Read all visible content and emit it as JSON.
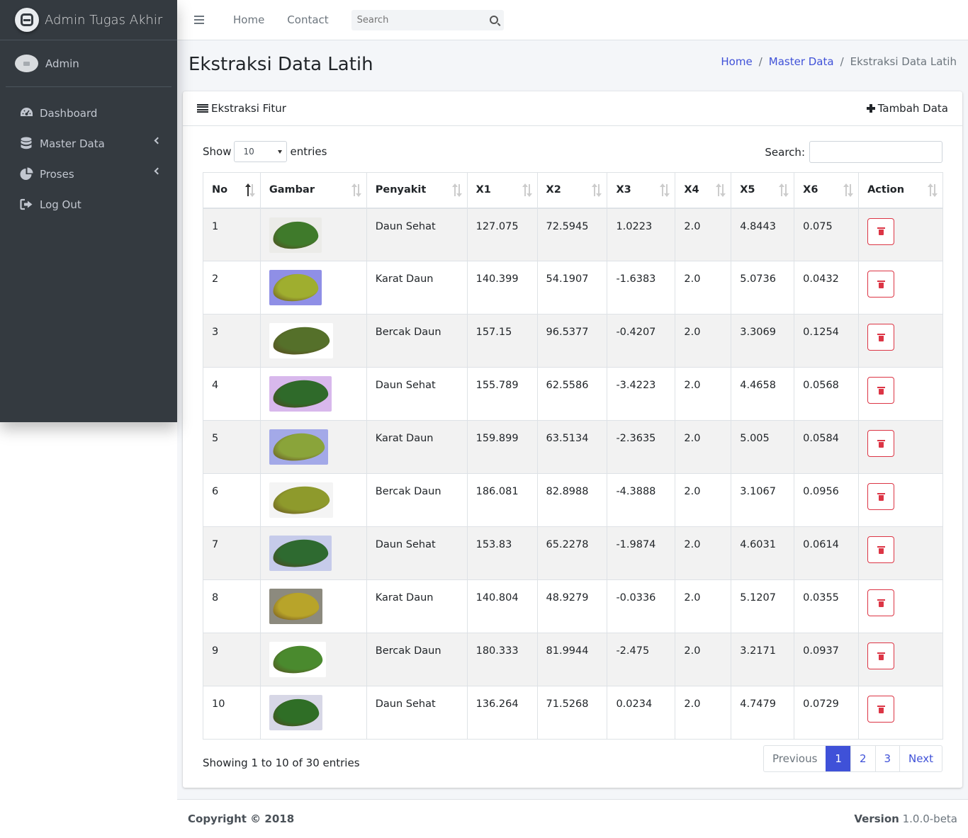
{
  "brand": {
    "title": "Admin Tugas Akhir"
  },
  "user": {
    "name": "Admin"
  },
  "sidebar": {
    "items": [
      {
        "label": "Dashboard",
        "icon": "dashboard-icon",
        "has_arrow": false
      },
      {
        "label": "Master Data",
        "icon": "database-icon",
        "has_arrow": true
      },
      {
        "label": "Proses",
        "icon": "pie-chart-icon",
        "has_arrow": true
      },
      {
        "label": "Log Out",
        "icon": "sign-out-icon",
        "has_arrow": false
      }
    ]
  },
  "topnav": {
    "links": [
      "Home",
      "Contact"
    ],
    "search_placeholder": "Search"
  },
  "page": {
    "title": "Ekstraksi Data Latih",
    "breadcrumb": {
      "home": "Home",
      "master": "Master Data",
      "current": "Ekstraksi Data Latih"
    }
  },
  "card": {
    "title": "Ekstraksi Fitur",
    "add_label": "Tambah Data"
  },
  "datatable": {
    "show_label": "Show",
    "entries_label": "entries",
    "page_length": "10",
    "search_label": "Search:",
    "columns": [
      "No",
      "Gambar",
      "Penyakit",
      "X1",
      "X2",
      "X3",
      "X4",
      "X5",
      "X6",
      "Action"
    ],
    "rows": [
      {
        "no": "1",
        "penyakit": "Daun Sehat",
        "x1": "127.075",
        "x2": "72.5945",
        "x3": "1.0223",
        "x4": "2.0",
        "x5": "4.8443",
        "x6": "0.075",
        "bg": "#ebebe8",
        "leaf": "#3f7a2b"
      },
      {
        "no": "2",
        "penyakit": "Karat Daun",
        "x1": "140.399",
        "x2": "54.1907",
        "x3": "-1.6383",
        "x4": "2.0",
        "x5": "5.0736",
        "x6": "0.0432",
        "bg": "#8f8fe6",
        "leaf": "#9fae2f"
      },
      {
        "no": "3",
        "penyakit": "Bercak Daun",
        "x1": "157.15",
        "x2": "96.5377",
        "x3": "-0.4207",
        "x4": "2.0",
        "x5": "3.3069",
        "x6": "0.1254",
        "bg": "#ffffff",
        "leaf": "#55702a"
      },
      {
        "no": "4",
        "penyakit": "Daun Sehat",
        "x1": "155.789",
        "x2": "62.5586",
        "x3": "-3.4223",
        "x4": "2.0",
        "x5": "4.4658",
        "x6": "0.0568",
        "bg": "#d8b8ec",
        "leaf": "#2f6a2a"
      },
      {
        "no": "5",
        "penyakit": "Karat Daun",
        "x1": "159.899",
        "x2": "63.5134",
        "x3": "-2.3635",
        "x4": "2.0",
        "x5": "5.005",
        "x6": "0.0584",
        "bg": "#a3a9e8",
        "leaf": "#8aa43a"
      },
      {
        "no": "6",
        "penyakit": "Bercak Daun",
        "x1": "186.081",
        "x2": "82.8988",
        "x3": "-4.3888",
        "x4": "2.0",
        "x5": "3.1067",
        "x6": "0.0956",
        "bg": "#f4f4f4",
        "leaf": "#8e9a2c"
      },
      {
        "no": "7",
        "penyakit": "Daun Sehat",
        "x1": "153.83",
        "x2": "65.2278",
        "x3": "-1.9874",
        "x4": "2.0",
        "x5": "4.6031",
        "x6": "0.0614",
        "bg": "#c6cbea",
        "leaf": "#2e6a30"
      },
      {
        "no": "8",
        "penyakit": "Karat Daun",
        "x1": "140.804",
        "x2": "48.9279",
        "x3": "-0.0336",
        "x4": "2.0",
        "x5": "5.1207",
        "x6": "0.0355",
        "bg": "#8c8a7e",
        "leaf": "#b8a42a"
      },
      {
        "no": "9",
        "penyakit": "Bercak Daun",
        "x1": "180.333",
        "x2": "81.9944",
        "x3": "-2.475",
        "x4": "2.0",
        "x5": "3.2171",
        "x6": "0.0937",
        "bg": "#ffffff",
        "leaf": "#4a8a2e"
      },
      {
        "no": "10",
        "penyakit": "Daun Sehat",
        "x1": "136.264",
        "x2": "71.5268",
        "x3": "0.0234",
        "x4": "2.0",
        "x5": "4.7479",
        "x6": "0.0729",
        "bg": "#d7d7e6",
        "leaf": "#2f6e26"
      }
    ],
    "info": "Showing 1 to 10 of 30 entries",
    "pagination": {
      "previous": "Previous",
      "pages": [
        "1",
        "2",
        "3"
      ],
      "current": "1",
      "next": "Next"
    }
  },
  "footer": {
    "copyright": "Copyright © 2018",
    "version_label": "Version",
    "version": "1.0.0-beta"
  },
  "colors": {
    "sidebar": "#343a40",
    "accent": "#3f51d8",
    "danger": "#dc3545"
  }
}
